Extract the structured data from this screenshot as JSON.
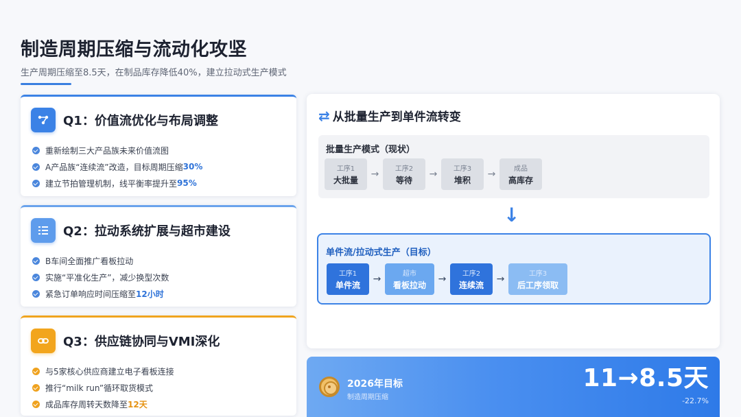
{
  "header": {
    "title": "制造周期压缩与流动化攻坚",
    "subtitle": "生产周期压缩至8.5天，在制品库存降低40%，建立拉动式生产模式"
  },
  "quarters": [
    {
      "title": "Q1：价值流优化与布局调整",
      "icon": "value-stream-icon",
      "items": [
        {
          "text": "重新绘制三大产品族未来价值流图",
          "highlight": ""
        },
        {
          "text": "A产品族“连续流”改造，目标周期压缩",
          "highlight": "30%"
        },
        {
          "text": "建立节拍管理机制，线平衡率提升至",
          "highlight": "95%"
        }
      ]
    },
    {
      "title": "Q2：拉动系统扩展与超市建设",
      "icon": "checklist-icon",
      "items": [
        {
          "text": "B车间全面推广看板拉动",
          "highlight": ""
        },
        {
          "text": "实施“平准化生产”，减少换型次数",
          "highlight": ""
        },
        {
          "text": "紧急订单响应时间压缩至",
          "highlight": "12小时"
        }
      ]
    },
    {
      "title": "Q3：供应链协同与VMI深化",
      "icon": "link-icon",
      "items": [
        {
          "text": "与5家核心供应商建立电子看板连接",
          "highlight": ""
        },
        {
          "text": "推行“milk run”循环取货模式",
          "highlight": ""
        },
        {
          "text": "成品库存周转天数降至",
          "highlight": "12天"
        }
      ]
    }
  ],
  "flow": {
    "title": "从批量生产到单件流转变",
    "batch": {
      "title": "批量生产模式（现状）",
      "steps": [
        {
          "top": "工序1",
          "bottom": "大批量"
        },
        {
          "top": "工序2",
          "bottom": "等待"
        },
        {
          "top": "工序3",
          "bottom": "堆积"
        },
        {
          "top": "成品",
          "bottom": "高库存"
        }
      ]
    },
    "pull": {
      "title": "单件流/拉动式生产（目标）",
      "steps": [
        {
          "top": "工序1",
          "bottom": "单件流"
        },
        {
          "top": "超市",
          "bottom": "看板拉动"
        },
        {
          "top": "工序2",
          "bottom": "连续流"
        },
        {
          "top": "工序3",
          "bottom": "后工序领取"
        }
      ]
    },
    "arrow": "→",
    "down_arrow": "↓",
    "swap_icon": "⇄"
  },
  "target": {
    "title": "2026年目标",
    "subtitle": "制造周期压缩",
    "value": "11→8.5天",
    "delta": "-22.7%"
  }
}
